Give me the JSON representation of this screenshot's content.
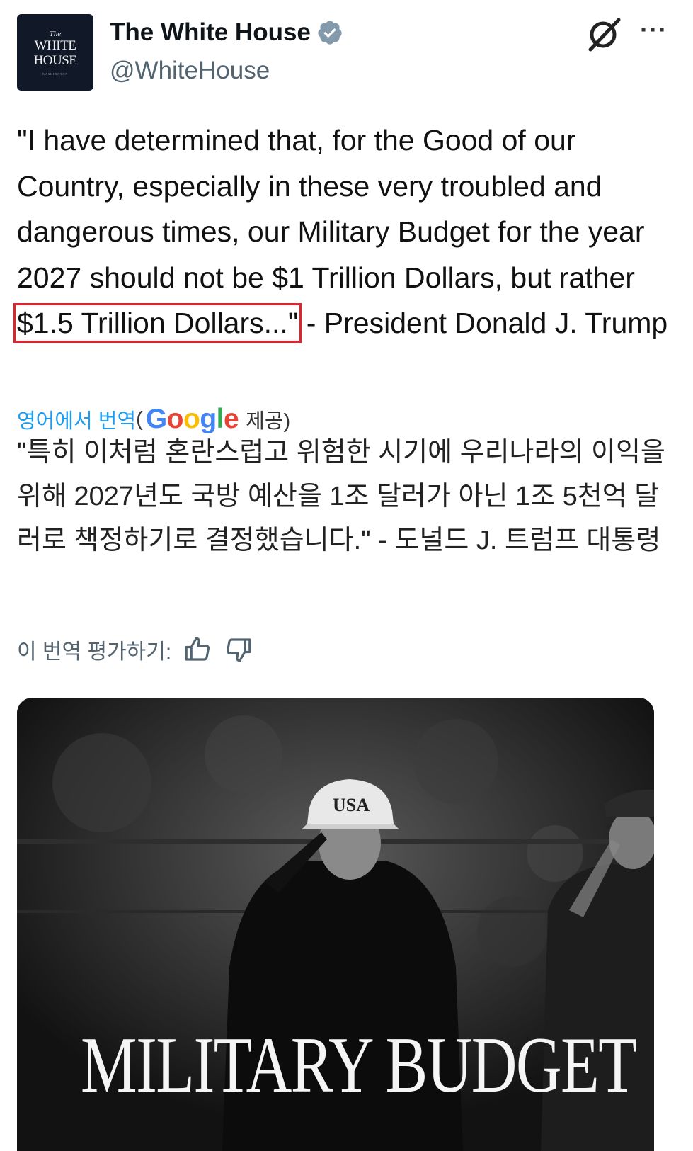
{
  "account": {
    "avatar_text_small": "The",
    "avatar_text_line1": "WHITE",
    "avatar_text_line2": "HOUSE",
    "avatar_text_sub": "WASHINGTON",
    "name": "The White House",
    "handle": "@WhiteHouse",
    "verified_icon": "verified-badge-icon",
    "badge_color": "#829aab"
  },
  "post": {
    "text_before": "\"I have determined that, for the Good of our Country, especially in these very troubled and dangerous times, our Military Budget for the year 2027 should not be $1 Trillion Dollars, but rather ",
    "text_highlight": "$1.5 Trillion Dollars...\"",
    "text_after": " - President Donald J. Trump",
    "highlight_color": "#d9262f"
  },
  "translation": {
    "link_label": "영어에서 번역",
    "paren_open": "(",
    "provider": "Google",
    "provided_label": "제공)",
    "text": "\"특히 이처럼 혼란스럽고 위험한 시기에 우리나라의 이익을 위해 2027년도 국방 예산을 1조 달러가 아닌 1조 5천억 달러로 책정하기로 결정했습니다.\" - 도널드 J. 트럼프 대통령",
    "rate_label": "이 번역 평가하기:"
  },
  "media": {
    "cap_text": "USA",
    "headline": "MILITARY BUDGET"
  },
  "colors": {
    "link": "#1d9bf0",
    "google_blue": "#4285f4",
    "google_red": "#ea4335",
    "google_yellow": "#fbbc05",
    "google_green": "#34a853"
  }
}
